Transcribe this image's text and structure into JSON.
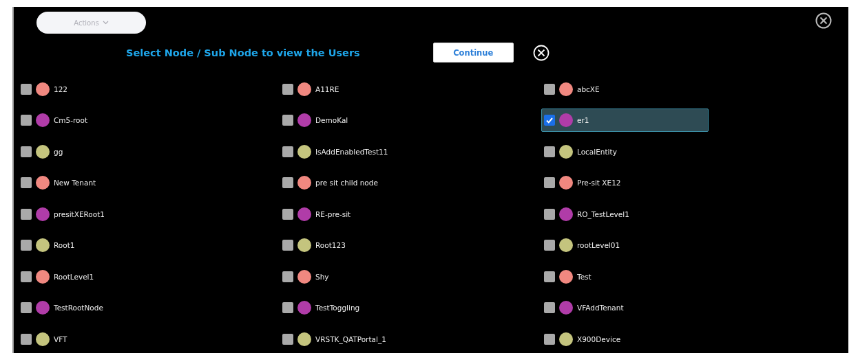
{
  "actions_button": {
    "label": "Actions"
  },
  "title": "Select Node / Sub Node to view the Users",
  "continue_button": {
    "label": "Continue"
  },
  "nodes": [
    {
      "label": "122",
      "color": "#f08880",
      "checked": false
    },
    {
      "label": "A11RE",
      "color": "#f08880",
      "checked": false
    },
    {
      "label": "abcXE",
      "color": "#f08880",
      "checked": false
    },
    {
      "label": "Cm5-root",
      "color": "#b03ca8",
      "checked": false
    },
    {
      "label": "DemoKal",
      "color": "#b03ca8",
      "checked": false
    },
    {
      "label": "er1",
      "color": "#b03ca8",
      "checked": true
    },
    {
      "label": "gg",
      "color": "#c4c47e",
      "checked": false
    },
    {
      "label": "IsAddEnabledTest11",
      "color": "#c4c47e",
      "checked": false
    },
    {
      "label": "LocalEntity",
      "color": "#c4c47e",
      "checked": false
    },
    {
      "label": "New Tenant",
      "color": "#f08880",
      "checked": false
    },
    {
      "label": "pre sit child node",
      "color": "#f08880",
      "checked": false
    },
    {
      "label": "Pre-sit XE12",
      "color": "#f08880",
      "checked": false
    },
    {
      "label": "presitXERoot1",
      "color": "#b03ca8",
      "checked": false
    },
    {
      "label": "RE-pre-sit",
      "color": "#b03ca8",
      "checked": false
    },
    {
      "label": "RO_TestLevel1",
      "color": "#b03ca8",
      "checked": false
    },
    {
      "label": "Root1",
      "color": "#c4c47e",
      "checked": false
    },
    {
      "label": "Root123",
      "color": "#c4c47e",
      "checked": false
    },
    {
      "label": "rootLevel01",
      "color": "#c4c47e",
      "checked": false
    },
    {
      "label": "RootLevel1",
      "color": "#f08880",
      "checked": false
    },
    {
      "label": "Shy",
      "color": "#f08880",
      "checked": false
    },
    {
      "label": "Test",
      "color": "#f08880",
      "checked": false
    },
    {
      "label": "TestRootNode",
      "color": "#b03ca8",
      "checked": false
    },
    {
      "label": "TestToggling",
      "color": "#b03ca8",
      "checked": false
    },
    {
      "label": "VFAddTenant",
      "color": "#b03ca8",
      "checked": false
    },
    {
      "label": "VFT",
      "color": "#c4c47e",
      "checked": false
    },
    {
      "label": "VRSTK_QATPortal_1",
      "color": "#c4c47e",
      "checked": false
    },
    {
      "label": "X900Device",
      "color": "#c4c47e",
      "checked": false
    }
  ]
}
